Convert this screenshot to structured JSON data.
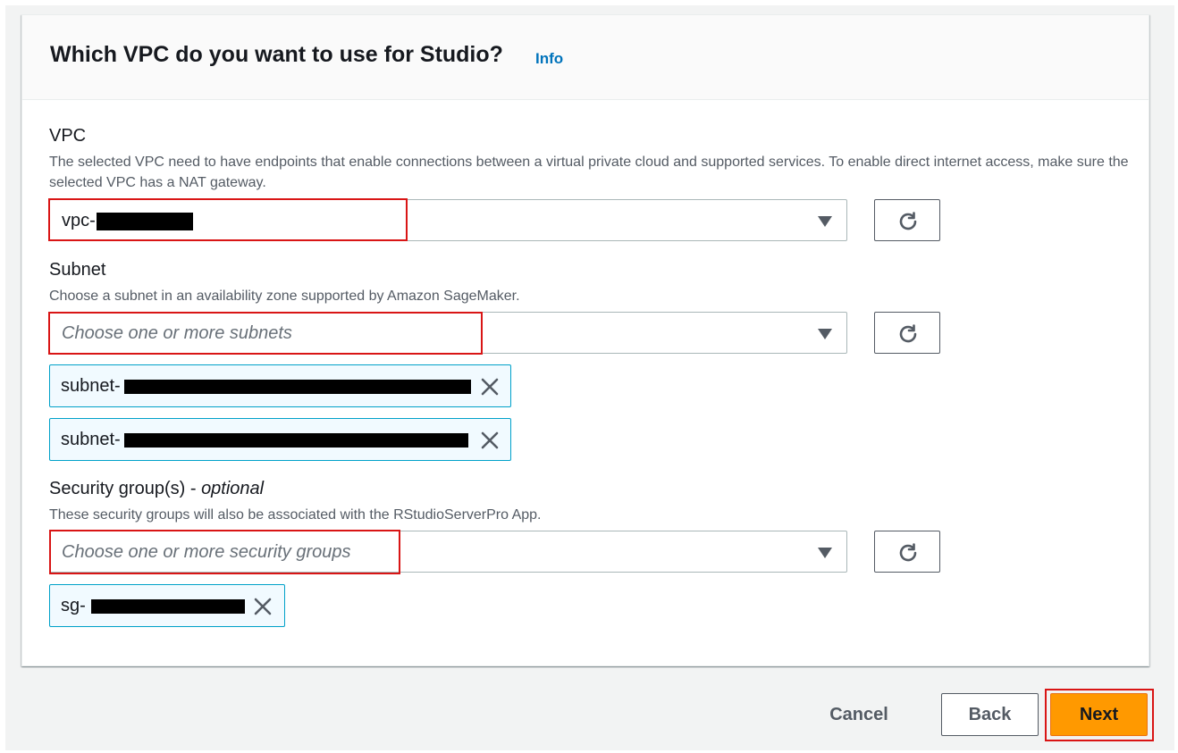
{
  "header": {
    "title": "Which VPC do you want to use for Studio?",
    "info_link": "Info"
  },
  "vpc": {
    "label": "VPC",
    "description": "The selected VPC need to have endpoints that enable connections between a virtual private cloud and supported services. To enable direct internet access, make sure the selected VPC has a NAT gateway.",
    "selected_value": "vpc-"
  },
  "subnet": {
    "label": "Subnet",
    "description": "Choose a subnet in an availability zone supported by Amazon SageMaker.",
    "placeholder": "Choose one or more subnets",
    "tokens": [
      {
        "label": "subnet-"
      },
      {
        "label": "subnet-"
      }
    ]
  },
  "security_groups": {
    "label": "Security group(s)",
    "label_separator": " - ",
    "optional": "optional",
    "description": "These security groups will also be associated with the RStudioServerPro App.",
    "placeholder": "Choose one or more security groups",
    "tokens": [
      {
        "label": "sg-"
      }
    ]
  },
  "footer": {
    "cancel_label": "Cancel",
    "back_label": "Back",
    "next_label": "Next"
  },
  "icons": {
    "refresh": "refresh-icon",
    "dropdown": "caret-down-icon",
    "remove": "close-icon"
  },
  "colors": {
    "primary_button": "#ff9900",
    "link": "#0073bb",
    "token_border": "#00a1c9",
    "highlight": "#d91515"
  }
}
